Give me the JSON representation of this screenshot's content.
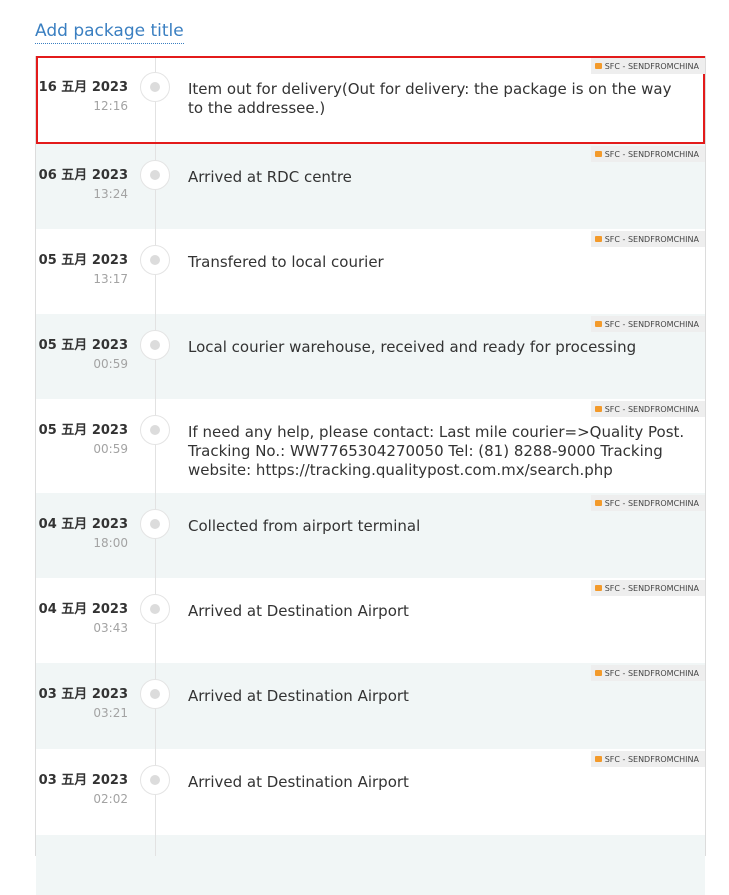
{
  "package_title_link": "Add package title",
  "carrier_badge": "SFC - SENDFROMCHINA",
  "events": [
    {
      "date": "16 五月 2023",
      "time": "12:16",
      "description": "Item out for delivery(Out for delivery: the package is on the way to the addressee.)"
    },
    {
      "date": "06 五月 2023",
      "time": "13:24",
      "description": "Arrived at RDC centre"
    },
    {
      "date": "05 五月 2023",
      "time": "13:17",
      "description": "Transfered to local courier"
    },
    {
      "date": "05 五月 2023",
      "time": "00:59",
      "description": "Local courier warehouse, received and ready for processing"
    },
    {
      "date": "05 五月 2023",
      "time": "00:59",
      "description": "If need any help, please contact: Last mile courier=>Quality Post. Tracking No.: WW7765304270050 Tel: (81) 8288-9000 Tracking website: https://tracking.qualitypost.com.mx/search.php"
    },
    {
      "date": "04 五月 2023",
      "time": "18:00",
      "description": "Collected from airport terminal"
    },
    {
      "date": "04 五月 2023",
      "time": "03:43",
      "description": "Arrived at Destination Airport"
    },
    {
      "date": "03 五月 2023",
      "time": "03:21",
      "description": "Arrived at Destination Airport"
    },
    {
      "date": "03 五月 2023",
      "time": "02:02",
      "description": "Arrived at Destination Airport"
    }
  ]
}
